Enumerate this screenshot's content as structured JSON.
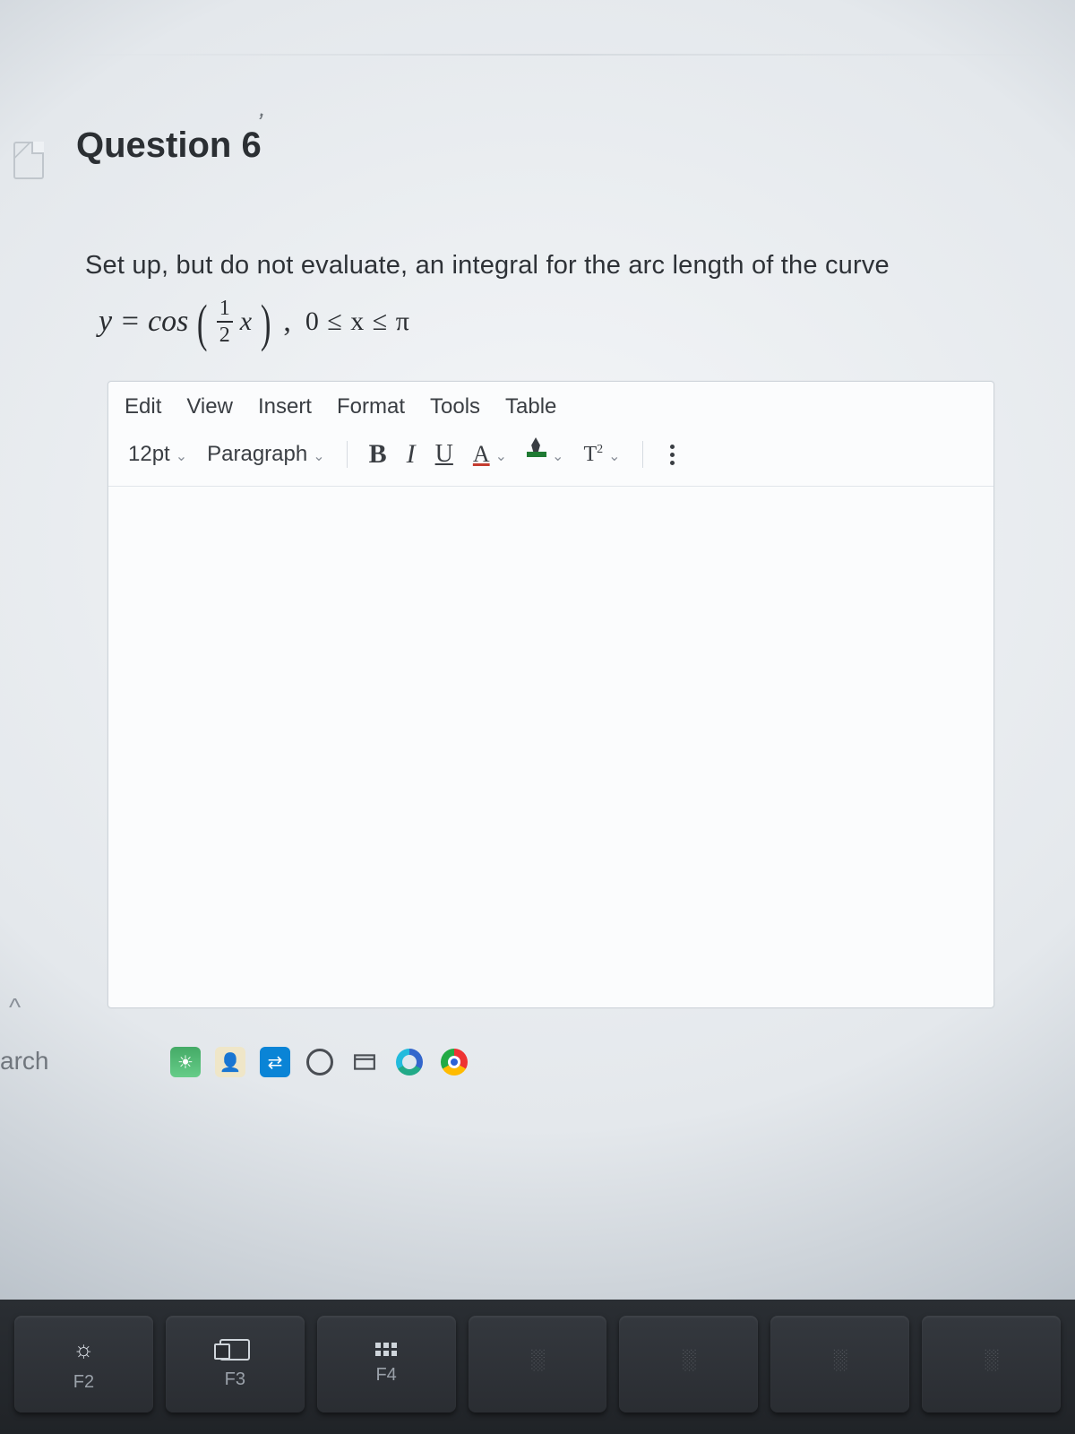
{
  "question": {
    "title": "Question 6",
    "prompt": "Set up, but do not evaluate, an integral for the arc length of the curve",
    "equation": {
      "lhs": "y = cos",
      "frac_num": "1",
      "frac_den": "2",
      "var": "x",
      "domain": "0 ≤ x ≤ π"
    }
  },
  "editor": {
    "menus": [
      "Edit",
      "View",
      "Insert",
      "Format",
      "Tools",
      "Table"
    ],
    "font_size": "12pt",
    "para_style": "Paragraph",
    "buttons": {
      "bold": "B",
      "italic": "I",
      "underline": "U",
      "textcolor": "A",
      "superscript": "T²"
    }
  },
  "side": {
    "caret": "^",
    "frag": "arch"
  },
  "keys": [
    {
      "label": "F2"
    },
    {
      "label": "F3"
    },
    {
      "label": "F4"
    },
    {
      "label": ""
    },
    {
      "label": ""
    },
    {
      "label": ""
    },
    {
      "label": ""
    }
  ]
}
